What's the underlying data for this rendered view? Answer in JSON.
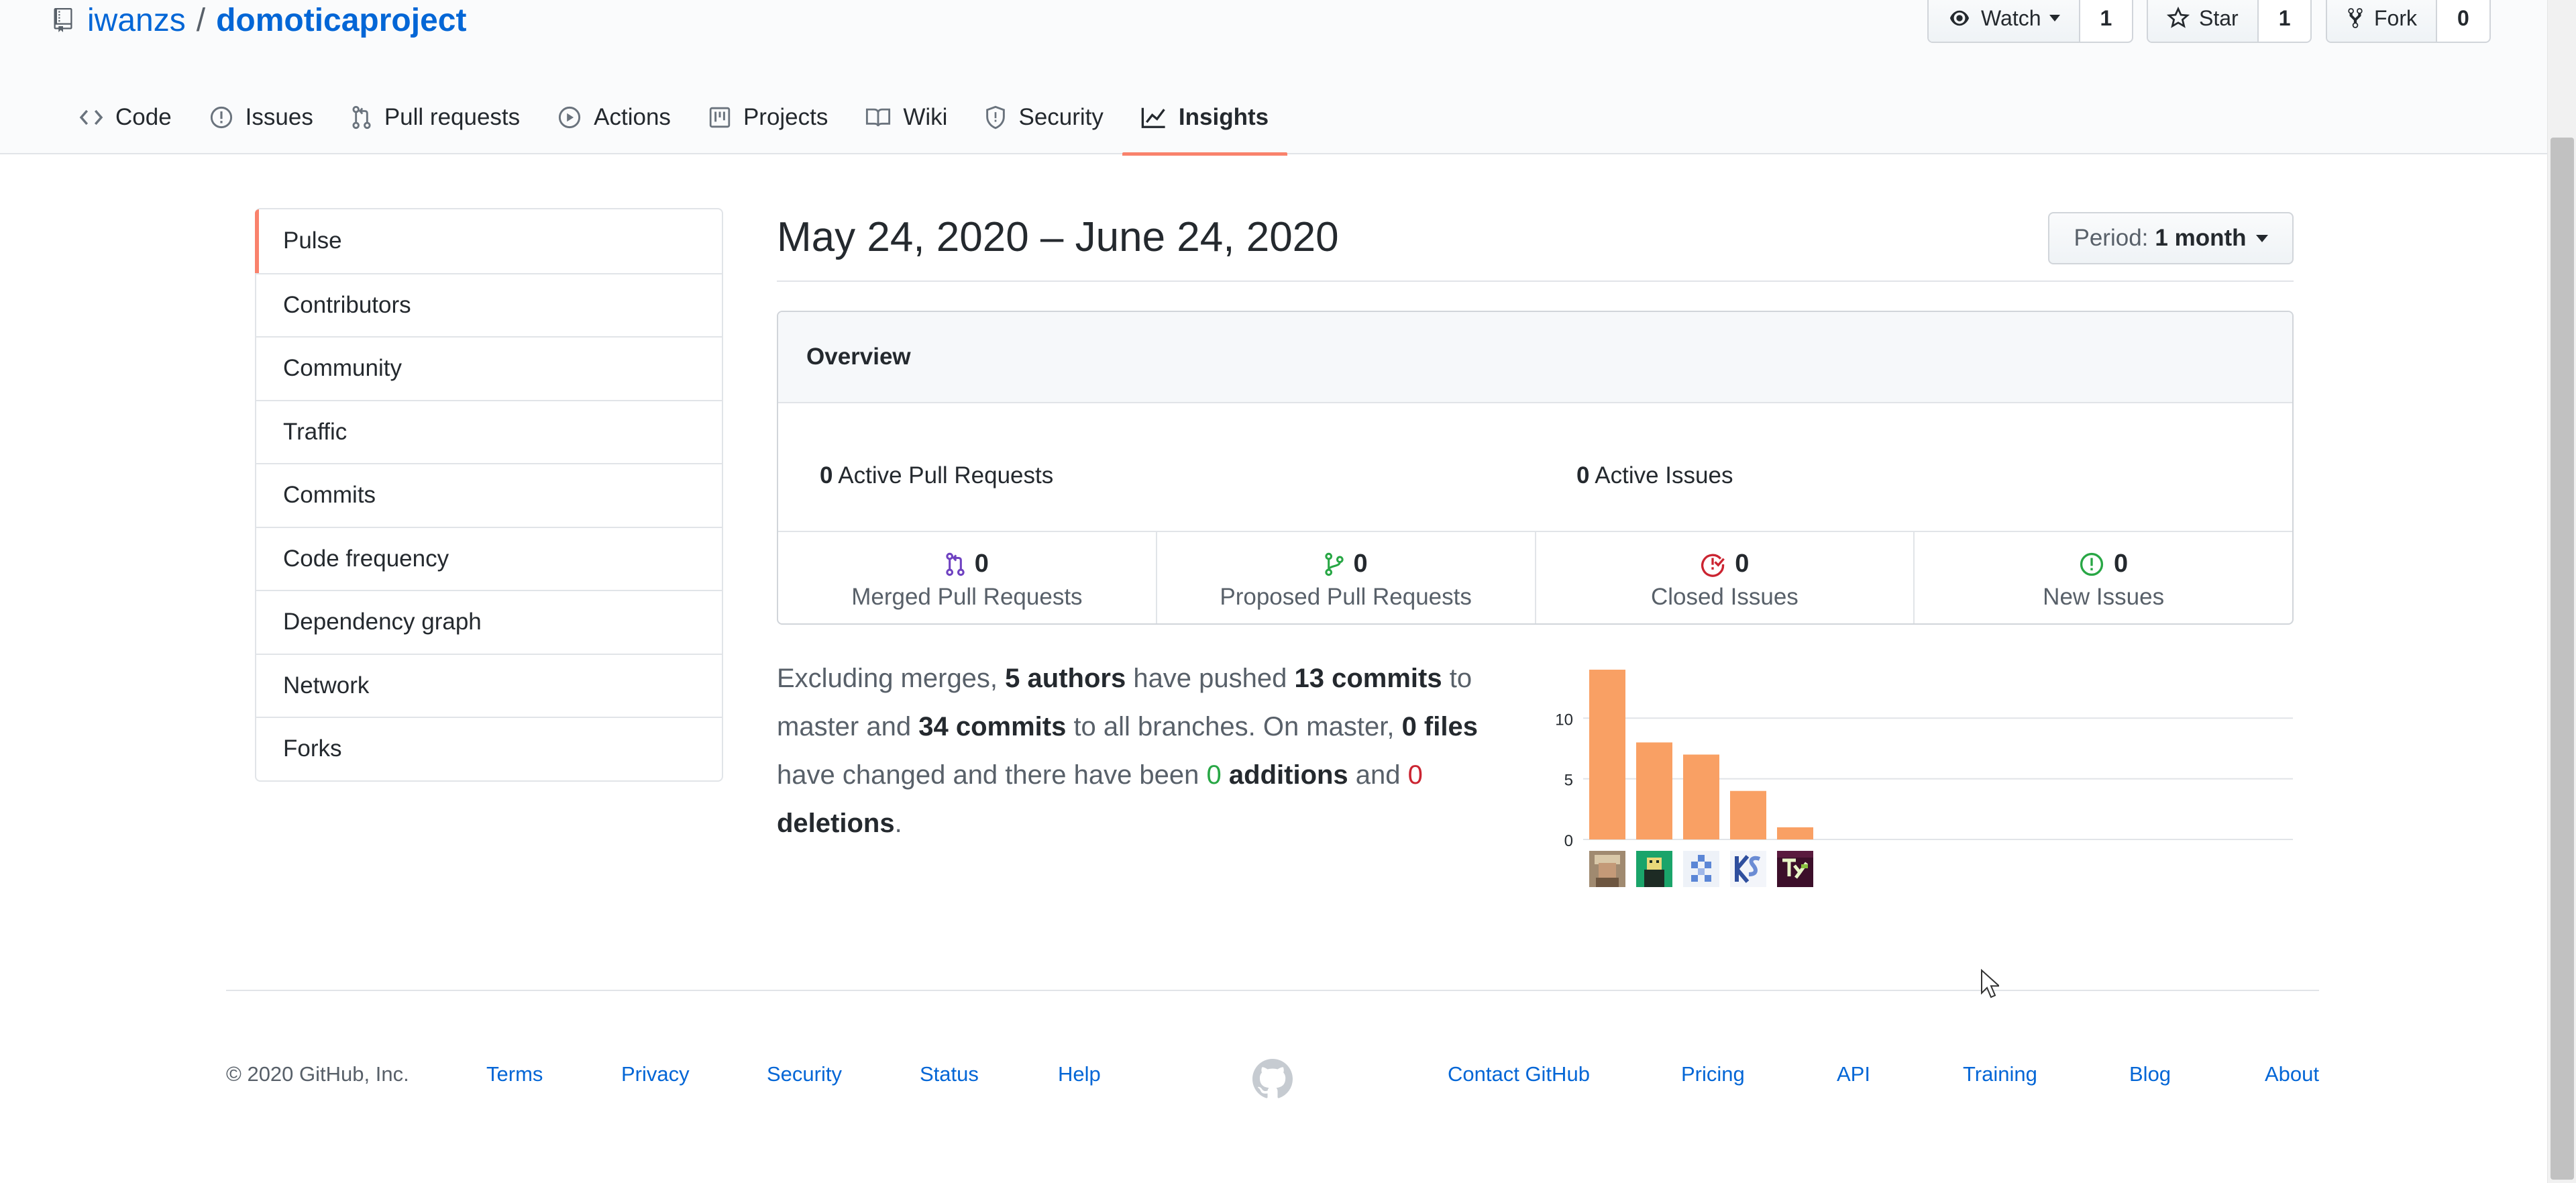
{
  "repo": {
    "owner": "iwanzs",
    "separator": "/",
    "name": "domoticaproject"
  },
  "social": {
    "watch": {
      "label": "Watch",
      "count": "1"
    },
    "star": {
      "label": "Star",
      "count": "1"
    },
    "fork": {
      "label": "Fork",
      "count": "0"
    }
  },
  "tabs": [
    {
      "label": "Code",
      "icon": "code-icon"
    },
    {
      "label": "Issues",
      "icon": "issue-opened-icon"
    },
    {
      "label": "Pull requests",
      "icon": "git-pull-request-icon"
    },
    {
      "label": "Actions",
      "icon": "play-icon"
    },
    {
      "label": "Projects",
      "icon": "project-icon"
    },
    {
      "label": "Wiki",
      "icon": "book-icon"
    },
    {
      "label": "Security",
      "icon": "shield-icon"
    },
    {
      "label": "Insights",
      "icon": "graph-icon",
      "selected": true
    }
  ],
  "sidebar": {
    "items": [
      {
        "label": "Pulse",
        "selected": true
      },
      {
        "label": "Contributors"
      },
      {
        "label": "Community"
      },
      {
        "label": "Traffic"
      },
      {
        "label": "Commits"
      },
      {
        "label": "Code frequency"
      },
      {
        "label": "Dependency graph"
      },
      {
        "label": "Network"
      },
      {
        "label": "Forks"
      }
    ]
  },
  "pulse": {
    "date_range": "May 24, 2020 – June 24, 2020",
    "period_label": "Period:",
    "period_value": "1 month"
  },
  "overview": {
    "title": "Overview",
    "active_prs_count": "0",
    "active_prs_label": "Active Pull Requests",
    "active_issues_count": "0",
    "active_issues_label": "Active Issues",
    "stats": [
      {
        "count": "0",
        "label": "Merged Pull Requests",
        "icon": "git-merge-icon",
        "color": "#6f42c1"
      },
      {
        "count": "0",
        "label": "Proposed Pull Requests",
        "icon": "git-pull-request-icon",
        "color": "#28a745"
      },
      {
        "count": "0",
        "label": "Closed Issues",
        "icon": "issue-closed-icon",
        "color": "#cb2431"
      },
      {
        "count": "0",
        "label": "New Issues",
        "icon": "issue-opened-icon",
        "color": "#28a745"
      }
    ]
  },
  "summary": {
    "t1": "Excluding merges, ",
    "authors": "5 authors",
    "t2": " have pushed ",
    "commits_master": "13 commits",
    "t3": " to master and ",
    "commits_all": "34 commits",
    "t4": " to all branches. On master, ",
    "files": "0 files",
    "t5": " have changed and there have been ",
    "additions_count": "0",
    "additions_label": "additions",
    "t6": " and ",
    "deletions_count": "0",
    "deletions_label": "deletions",
    "t7": "."
  },
  "chart_data": {
    "type": "bar",
    "categories": [
      "author-1",
      "author-2",
      "author-3",
      "author-4",
      "author-5"
    ],
    "values": [
      14,
      8,
      7,
      4,
      1
    ],
    "yticks": [
      0,
      5,
      10
    ],
    "ylim": [
      0,
      14
    ],
    "bar_color": "#f9a064",
    "grid": true
  },
  "footer": {
    "copyright": "© 2020 GitHub, Inc.",
    "links_left": [
      "Terms",
      "Privacy",
      "Security",
      "Status",
      "Help"
    ],
    "links_right": [
      "Contact GitHub",
      "Pricing",
      "API",
      "Training",
      "Blog",
      "About"
    ]
  },
  "colors": {
    "accent": "#f9826c",
    "link": "#0366d6"
  }
}
